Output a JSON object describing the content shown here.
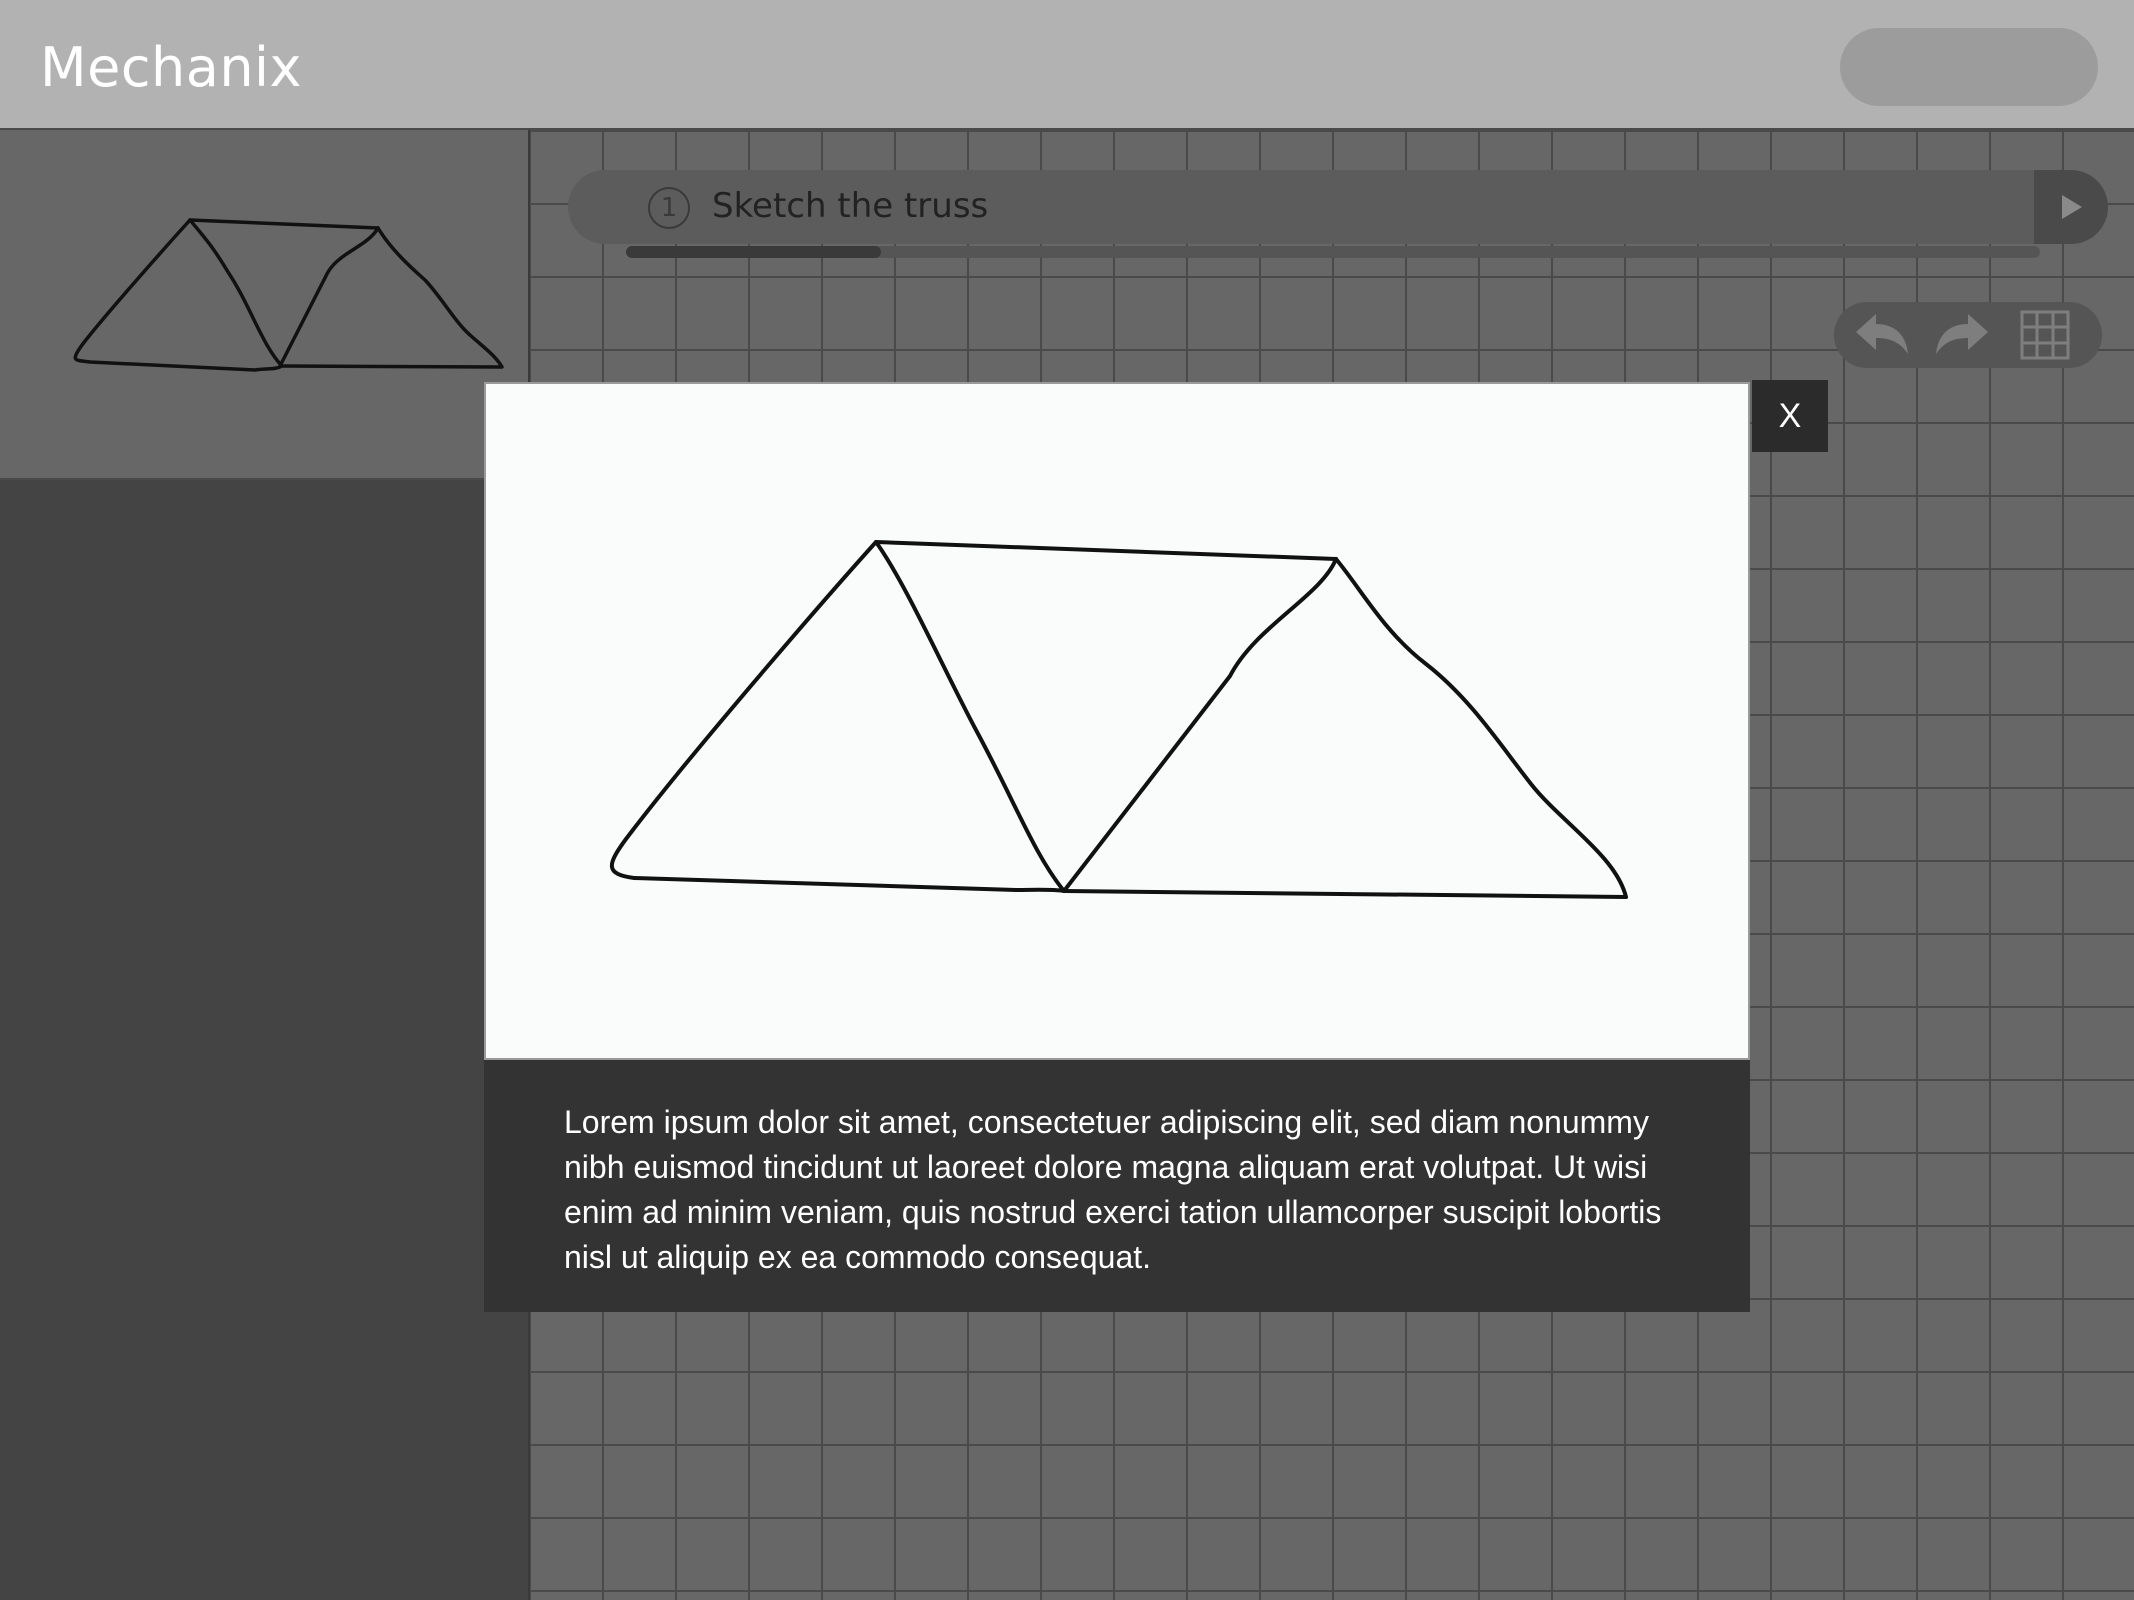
{
  "app": {
    "title": "Mechanix"
  },
  "step": {
    "number": "1",
    "label": "Sketch the truss",
    "progress": 0.18
  },
  "toolbar": {
    "undo": "undo-icon",
    "redo": "redo-icon",
    "grid": "grid-icon"
  },
  "modal": {
    "close_label": "X",
    "description": "Lorem ipsum dolor sit amet, consectetuer adipiscing elit, sed diam nonummy nibh euismod tincidunt ut laoreet dolore magna aliquam erat volutpat. Ut wisi enim ad minim veniam, quis nostrud exerci tation ullamcorper suscipit lobortis nisl ut aliquip ex ea commodo consequat."
  }
}
